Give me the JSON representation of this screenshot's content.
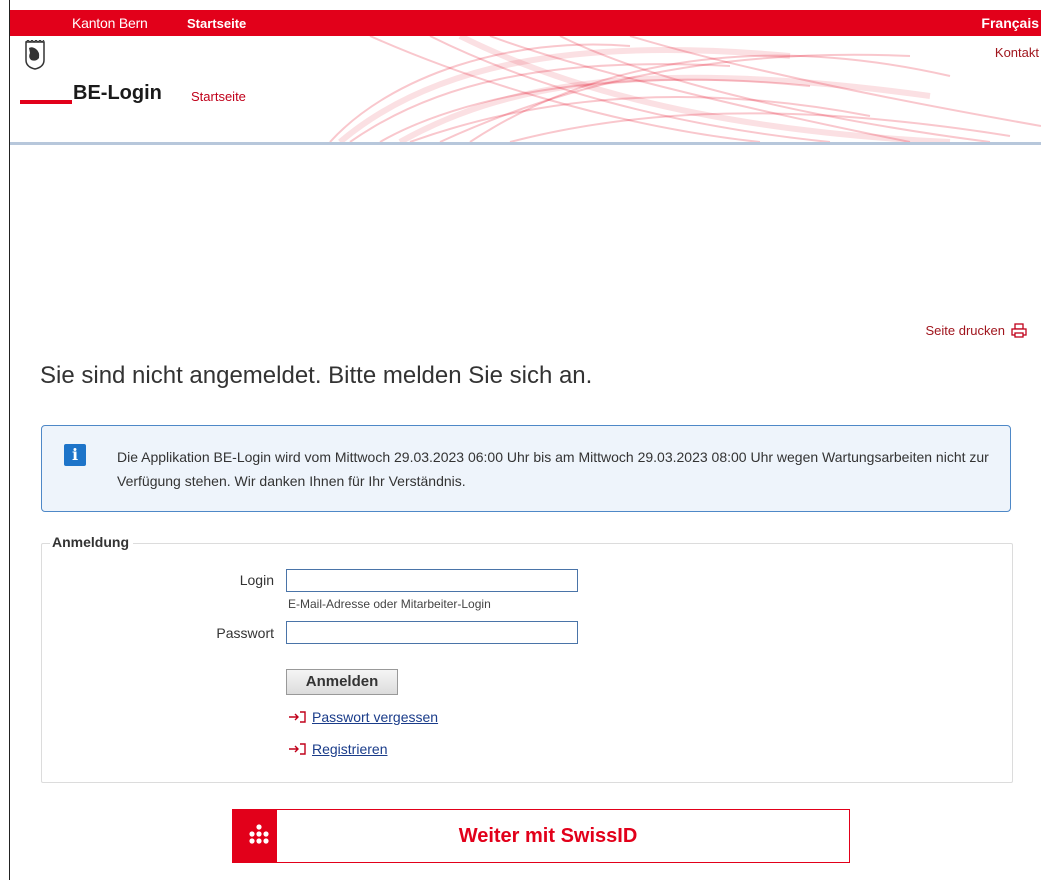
{
  "topbar": {
    "brand": "Kanton Bern",
    "home_link": "Startseite",
    "language_link": "Français"
  },
  "header": {
    "app_title": "BE-Login",
    "home_link": "Startseite",
    "contact_link": "Kontakt"
  },
  "page": {
    "print_label": "Seite drucken",
    "headline": "Sie sind nicht angemeldet. Bitte melden Sie sich an."
  },
  "notice": {
    "message": "Die Applikation BE-Login wird vom Mittwoch 29.03.2023 06:00 Uhr bis am Mittwoch 29.03.2023 08:00 Uhr wegen Wartungsarbeiten nicht zur Verfügung stehen. Wir danken Ihnen für Ihr Verständnis."
  },
  "login_form": {
    "legend": "Anmeldung",
    "login_label": "Login",
    "login_value": "",
    "login_hint": "E-Mail-Adresse oder Mitarbeiter-Login",
    "password_label": "Passwort",
    "password_value": "",
    "submit_label": "Anmelden",
    "forgot_password_link": "Passwort vergessen",
    "register_link": "Registrieren"
  },
  "swissid": {
    "button_label": "Weiter mit SwissID"
  },
  "colors": {
    "brand_red": "#e2001a",
    "info_blue": "#1d74c9",
    "link_blue": "#1a3c8a"
  }
}
